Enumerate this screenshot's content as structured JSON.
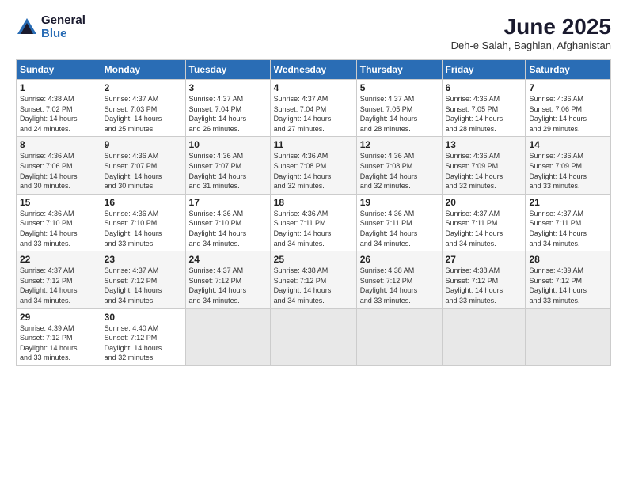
{
  "header": {
    "logo_general": "General",
    "logo_blue": "Blue",
    "month_year": "June 2025",
    "location": "Deh-e Salah, Baghlan, Afghanistan"
  },
  "weekdays": [
    "Sunday",
    "Monday",
    "Tuesday",
    "Wednesday",
    "Thursday",
    "Friday",
    "Saturday"
  ],
  "weeks": [
    [
      {
        "day": "1",
        "info": "Sunrise: 4:38 AM\nSunset: 7:02 PM\nDaylight: 14 hours\nand 24 minutes."
      },
      {
        "day": "2",
        "info": "Sunrise: 4:37 AM\nSunset: 7:03 PM\nDaylight: 14 hours\nand 25 minutes."
      },
      {
        "day": "3",
        "info": "Sunrise: 4:37 AM\nSunset: 7:04 PM\nDaylight: 14 hours\nand 26 minutes."
      },
      {
        "day": "4",
        "info": "Sunrise: 4:37 AM\nSunset: 7:04 PM\nDaylight: 14 hours\nand 27 minutes."
      },
      {
        "day": "5",
        "info": "Sunrise: 4:37 AM\nSunset: 7:05 PM\nDaylight: 14 hours\nand 28 minutes."
      },
      {
        "day": "6",
        "info": "Sunrise: 4:36 AM\nSunset: 7:05 PM\nDaylight: 14 hours\nand 28 minutes."
      },
      {
        "day": "7",
        "info": "Sunrise: 4:36 AM\nSunset: 7:06 PM\nDaylight: 14 hours\nand 29 minutes."
      }
    ],
    [
      {
        "day": "8",
        "info": "Sunrise: 4:36 AM\nSunset: 7:06 PM\nDaylight: 14 hours\nand 30 minutes."
      },
      {
        "day": "9",
        "info": "Sunrise: 4:36 AM\nSunset: 7:07 PM\nDaylight: 14 hours\nand 30 minutes."
      },
      {
        "day": "10",
        "info": "Sunrise: 4:36 AM\nSunset: 7:07 PM\nDaylight: 14 hours\nand 31 minutes."
      },
      {
        "day": "11",
        "info": "Sunrise: 4:36 AM\nSunset: 7:08 PM\nDaylight: 14 hours\nand 32 minutes."
      },
      {
        "day": "12",
        "info": "Sunrise: 4:36 AM\nSunset: 7:08 PM\nDaylight: 14 hours\nand 32 minutes."
      },
      {
        "day": "13",
        "info": "Sunrise: 4:36 AM\nSunset: 7:09 PM\nDaylight: 14 hours\nand 32 minutes."
      },
      {
        "day": "14",
        "info": "Sunrise: 4:36 AM\nSunset: 7:09 PM\nDaylight: 14 hours\nand 33 minutes."
      }
    ],
    [
      {
        "day": "15",
        "info": "Sunrise: 4:36 AM\nSunset: 7:10 PM\nDaylight: 14 hours\nand 33 minutes."
      },
      {
        "day": "16",
        "info": "Sunrise: 4:36 AM\nSunset: 7:10 PM\nDaylight: 14 hours\nand 33 minutes."
      },
      {
        "day": "17",
        "info": "Sunrise: 4:36 AM\nSunset: 7:10 PM\nDaylight: 14 hours\nand 34 minutes."
      },
      {
        "day": "18",
        "info": "Sunrise: 4:36 AM\nSunset: 7:11 PM\nDaylight: 14 hours\nand 34 minutes."
      },
      {
        "day": "19",
        "info": "Sunrise: 4:36 AM\nSunset: 7:11 PM\nDaylight: 14 hours\nand 34 minutes."
      },
      {
        "day": "20",
        "info": "Sunrise: 4:37 AM\nSunset: 7:11 PM\nDaylight: 14 hours\nand 34 minutes."
      },
      {
        "day": "21",
        "info": "Sunrise: 4:37 AM\nSunset: 7:11 PM\nDaylight: 14 hours\nand 34 minutes."
      }
    ],
    [
      {
        "day": "22",
        "info": "Sunrise: 4:37 AM\nSunset: 7:12 PM\nDaylight: 14 hours\nand 34 minutes."
      },
      {
        "day": "23",
        "info": "Sunrise: 4:37 AM\nSunset: 7:12 PM\nDaylight: 14 hours\nand 34 minutes."
      },
      {
        "day": "24",
        "info": "Sunrise: 4:37 AM\nSunset: 7:12 PM\nDaylight: 14 hours\nand 34 minutes."
      },
      {
        "day": "25",
        "info": "Sunrise: 4:38 AM\nSunset: 7:12 PM\nDaylight: 14 hours\nand 34 minutes."
      },
      {
        "day": "26",
        "info": "Sunrise: 4:38 AM\nSunset: 7:12 PM\nDaylight: 14 hours\nand 33 minutes."
      },
      {
        "day": "27",
        "info": "Sunrise: 4:38 AM\nSunset: 7:12 PM\nDaylight: 14 hours\nand 33 minutes."
      },
      {
        "day": "28",
        "info": "Sunrise: 4:39 AM\nSunset: 7:12 PM\nDaylight: 14 hours\nand 33 minutes."
      }
    ],
    [
      {
        "day": "29",
        "info": "Sunrise: 4:39 AM\nSunset: 7:12 PM\nDaylight: 14 hours\nand 33 minutes."
      },
      {
        "day": "30",
        "info": "Sunrise: 4:40 AM\nSunset: 7:12 PM\nDaylight: 14 hours\nand 32 minutes."
      },
      {
        "day": "",
        "info": ""
      },
      {
        "day": "",
        "info": ""
      },
      {
        "day": "",
        "info": ""
      },
      {
        "day": "",
        "info": ""
      },
      {
        "day": "",
        "info": ""
      }
    ]
  ]
}
